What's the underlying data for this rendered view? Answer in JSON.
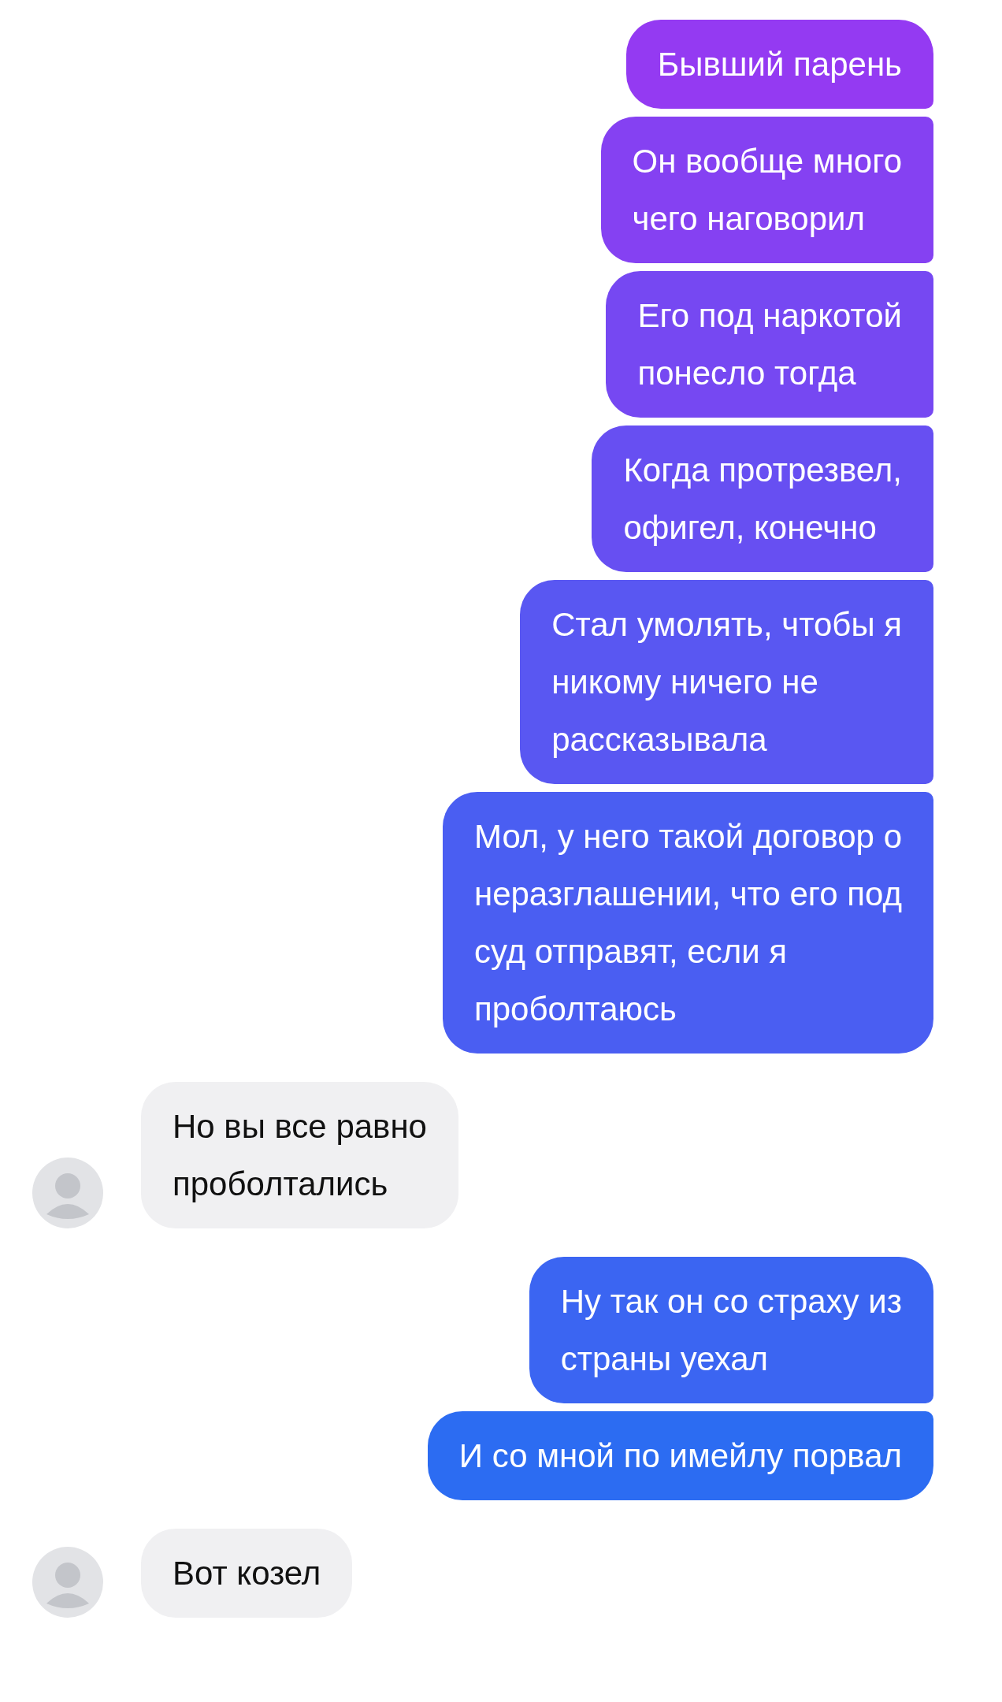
{
  "messages": [
    {
      "kind": "outgoing",
      "text": "Бывший парень"
    },
    {
      "kind": "outgoing",
      "text": "Он вообще много\nчего наговорил"
    },
    {
      "kind": "outgoing",
      "text": "Его под наркотой\nпонесло тогда"
    },
    {
      "kind": "outgoing",
      "text": "Когда протрезвел,\nофигел, конечно"
    },
    {
      "kind": "outgoing",
      "text": "Стал умолять, чтобы я\nникому ничего не\nрассказывала"
    },
    {
      "kind": "outgoing",
      "text": "Мол, у него такой договор о\nнеразглашении, что его под\nсуд отправят, если я\nпроболтаюсь"
    },
    {
      "kind": "incoming",
      "text": "Но вы все равно\nпроболтались"
    },
    {
      "kind": "outgoing",
      "text": "Ну так он со страху из\nстраны уехал"
    },
    {
      "kind": "outgoing",
      "text": "И со мной по имейлу порвал"
    },
    {
      "kind": "incoming",
      "text": "Вот козел"
    }
  ]
}
